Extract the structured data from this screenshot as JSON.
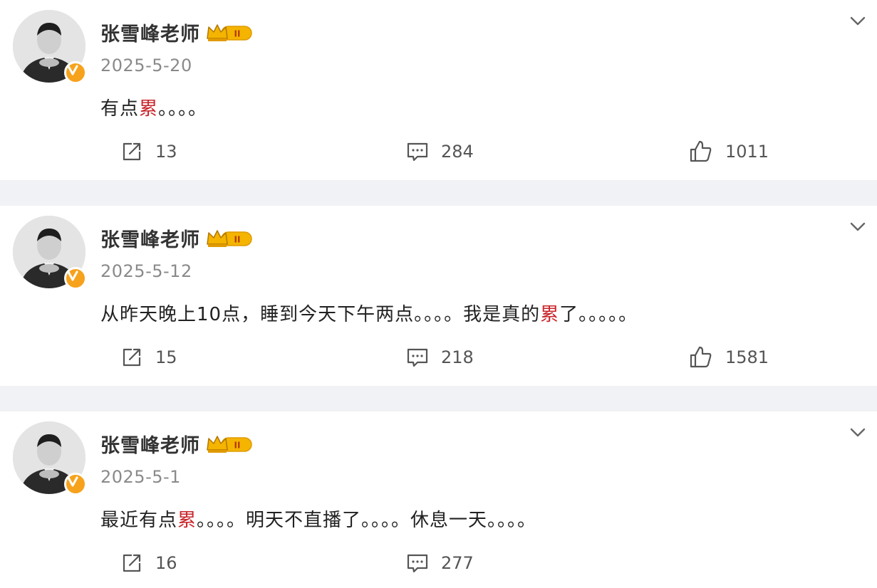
{
  "posts": [
    {
      "author": "张雪峰老师",
      "date": "2025-5-20",
      "content_before": "有点",
      "content_highlight": "累",
      "content_after": "。。。。",
      "reposts": "13",
      "comments": "284",
      "likes": "1011"
    },
    {
      "author": "张雪峰老师",
      "date": "2025-5-12",
      "content_before": "从昨天晚上10点，睡到今天下午两点。。。。我是真的",
      "content_highlight": "累",
      "content_after": "了。。。。。",
      "reposts": "15",
      "comments": "218",
      "likes": "1581"
    },
    {
      "author": "张雪峰老师",
      "date": "2025-5-1",
      "content_before": "最近有点",
      "content_highlight": "累",
      "content_after": "。。。。明天不直播了。。。。休息一天。。。。",
      "reposts": "16",
      "comments": "277",
      "likes": ""
    }
  ],
  "colors": {
    "highlight": "#c8252b",
    "verified_badge": "#f7a21c",
    "crown": "#f4b400",
    "background": "#f1f2f5"
  },
  "icons": {
    "repost": "repost-icon",
    "comment": "comment-icon",
    "like": "thumbs-up-icon",
    "more": "chevron-down-icon",
    "verified": "verified-v-icon",
    "membership": "crown-member-icon"
  }
}
